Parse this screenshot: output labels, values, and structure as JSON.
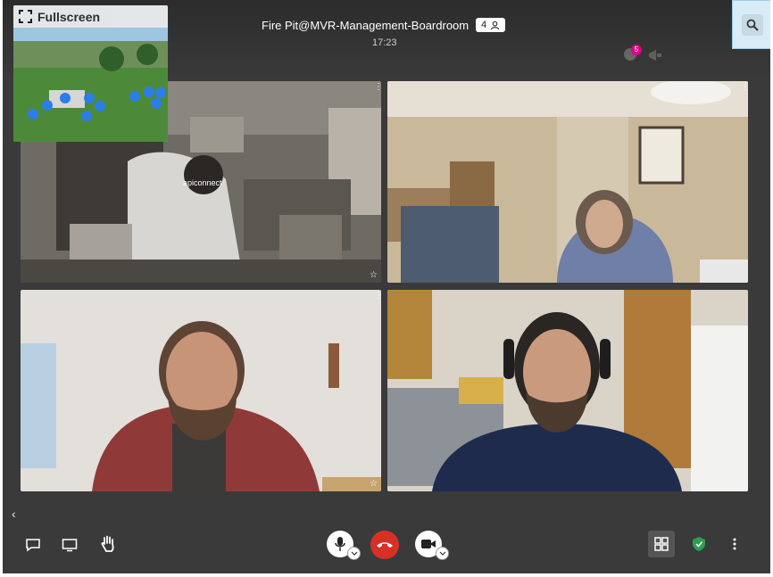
{
  "header": {
    "title": "Fire Pit@MVR-Management-Boardroom",
    "participant_count": "4",
    "time": "17:23",
    "notification_count": "5"
  },
  "filmstrip": {
    "fullscreen_label": "Fullscreen"
  },
  "tiles": [
    {
      "name": "apiconnect"
    },
    {
      "name": ""
    },
    {
      "name": ""
    },
    {
      "name": ""
    }
  ],
  "icons": {
    "search": "search-icon",
    "mic": "microphone-icon",
    "hangup": "phone-hangup-icon",
    "camera": "camera-icon",
    "chat": "chat-icon",
    "screen": "screen-share-icon",
    "hand": "raise-hand-icon",
    "grid": "grid-view-icon",
    "security": "shield-icon",
    "more": "more-vertical-icon"
  },
  "colors": {
    "hangup": "#d93025",
    "background": "#3a3a3a",
    "security": "#2e9e4f",
    "notification": "#e0008a"
  }
}
